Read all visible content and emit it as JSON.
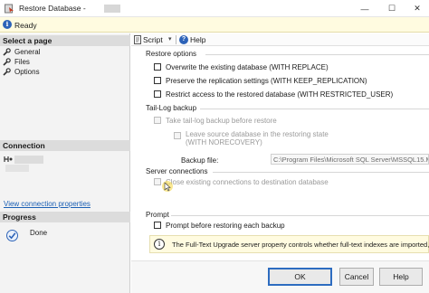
{
  "window": {
    "title": "Restore Database -",
    "minimize_glyph": "—",
    "maximize_glyph": "☐",
    "close_glyph": "✕"
  },
  "status": {
    "text": "Ready"
  },
  "left": {
    "select_page_header": "Select a page",
    "pages": [
      {
        "label": "General",
        "icon": "wrench-icon"
      },
      {
        "label": "Files",
        "icon": "wrench-icon"
      },
      {
        "label": "Options",
        "icon": "wrench-icon",
        "selected": true
      }
    ],
    "connection_header": "Connection",
    "view_connection_link": "View connection properties",
    "progress_header": "Progress",
    "progress_status": "Done"
  },
  "toolbar": {
    "script_label": "Script",
    "script_caret": "▾",
    "help_label": "Help"
  },
  "options": {
    "restore_options_title": "Restore options",
    "overwrite": {
      "label": "Overwrite the existing database (WITH REPLACE)",
      "checked": false
    },
    "preserve": {
      "label": "Preserve the replication settings (WITH KEEP_REPLICATION)",
      "checked": false
    },
    "restrict": {
      "label": "Restrict access to the restored database (WITH RESTRICTED_USER)",
      "checked": false
    },
    "tail_log_title": "Tail-Log backup",
    "take_tail": {
      "label": "Take tail-log backup before restore",
      "checked": false,
      "enabled": false
    },
    "leave_source_line1": "Leave source database in the restoring state",
    "leave_source_line2": "(WITH NORECOVERY)",
    "backup_file_label": "Backup file:",
    "backup_file_value": "C:\\Program Files\\Microsoft SQL Server\\MSSQL15.MS",
    "server_connections_title": "Server connections",
    "close_existing": {
      "label": "Close existing connections to destination database",
      "checked": false,
      "enabled": false
    },
    "prompt_title": "Prompt",
    "prompt_before": {
      "label": "Prompt before restoring each backup",
      "checked": false
    },
    "info_text": "The Full-Text Upgrade server property controls whether full-text indexes are imported, re"
  },
  "footer": {
    "ok_label": "OK",
    "cancel_label": "Cancel",
    "help_label": "Help"
  },
  "colors": {
    "accent": "#2d63b8",
    "link": "#1a5fb4",
    "info_bg": "#fffbe0",
    "cursor": "#f6d84a"
  }
}
